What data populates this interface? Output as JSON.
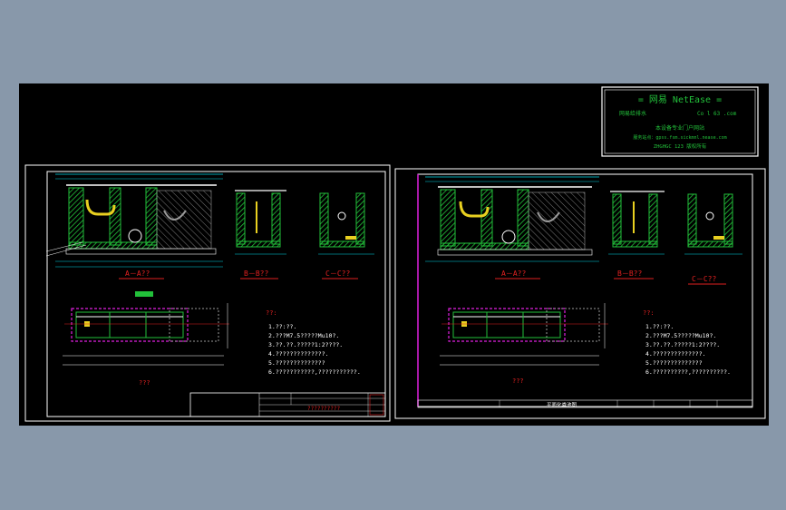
{
  "stamp": {
    "line1": "= 网易 NetEase =",
    "line2": "网易给排水",
    "line3": "Co l 63 .com",
    "line4": "本设备专业门户网站",
    "line5": "服务站点：gpss.fsm.sickmnl.nease.com",
    "line6": "ZHGHGC 123 版权所有"
  },
  "left_sheet": {
    "section_a": "A－A??",
    "section_b": "B－B??",
    "section_c": "C－C??",
    "notes_title": "??:",
    "notes": [
      "1.??:??.",
      "2.???M7.5?????Mu10?.",
      "3.??.??.?????1:2????.",
      "4.??????????????.",
      "5.??????????????",
      "6.???????????,???????????."
    ],
    "plan_title": "???",
    "titleblock_name": "??????????"
  },
  "right_sheet": {
    "section_a": "A－A??",
    "section_b": "B－B??",
    "section_c": "C－C??",
    "notes_title": "??:",
    "notes": [
      "1.??:??.",
      "2.???M7.5?????Mu10?.",
      "3.??.??.?????1:2????.",
      "4.??????????????.",
      "5.??????????????",
      "6.??????????,??????????."
    ],
    "plan_title": "???",
    "titleblock_name": "平面化粪池图"
  },
  "colors": {
    "background": "#000000",
    "frame": "#ffffff",
    "hatch_green": "#22c03a",
    "cyan": "#00d8e8",
    "red": "#e02020",
    "magenta": "#e020e0",
    "yellow": "#e8d020"
  }
}
